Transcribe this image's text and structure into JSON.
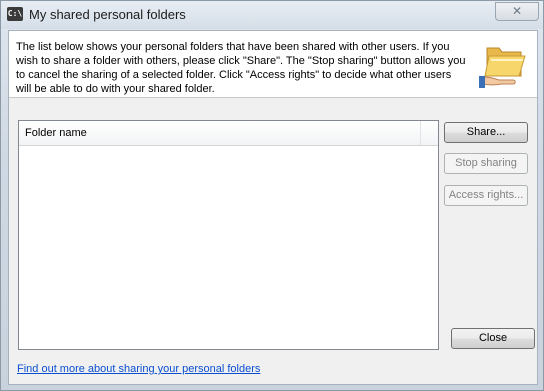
{
  "window": {
    "title": "My shared personal folders",
    "app_icon_text": "C:\\",
    "close_glyph": "✕"
  },
  "header": {
    "description": "The list below shows your personal folders that have been shared with other users. If you wish to share a folder with others, please click \"Share\". The \"Stop sharing\" button allows you to cancel the sharing of a selected folder. Click \"Access rights\" to decide what other users will be able to do with your shared folder.",
    "icon": "shared-folder-hand-icon"
  },
  "list": {
    "columns": [
      "Folder name"
    ],
    "rows": []
  },
  "buttons": {
    "share": "Share...",
    "stop_sharing": "Stop sharing",
    "access_rights": "Access rights...",
    "close": "Close"
  },
  "footer": {
    "link_text": "Find out more about sharing your personal folders"
  },
  "colors": {
    "link": "#0b4fd0",
    "folder_yellow": "#f4c542"
  }
}
